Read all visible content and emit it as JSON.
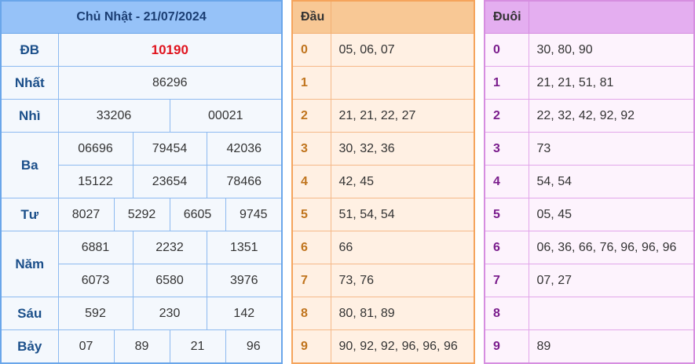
{
  "header": {
    "title": "Chủ Nhật - 21/07/2024"
  },
  "prizes": {
    "db": {
      "label": "ĐB",
      "values": [
        "10190"
      ]
    },
    "nhat": {
      "label": "Nhất",
      "values": [
        "86296"
      ]
    },
    "nhi": {
      "label": "Nhì",
      "values": [
        "33206",
        "00021"
      ]
    },
    "ba": {
      "label": "Ba",
      "values": [
        "06696",
        "79454",
        "42036",
        "15122",
        "23654",
        "78466"
      ]
    },
    "tu": {
      "label": "Tư",
      "values": [
        "8027",
        "5292",
        "6605",
        "9745"
      ]
    },
    "nam": {
      "label": "Năm",
      "values": [
        "6881",
        "2232",
        "1351",
        "6073",
        "6580",
        "3976"
      ]
    },
    "sau": {
      "label": "Sáu",
      "values": [
        "592",
        "230",
        "142"
      ]
    },
    "bay": {
      "label": "Bảy",
      "values": [
        "07",
        "89",
        "21",
        "96"
      ]
    }
  },
  "dau": {
    "title": "Đầu",
    "rows": [
      {
        "digit": "0",
        "values": "05, 06, 07"
      },
      {
        "digit": "1",
        "values": ""
      },
      {
        "digit": "2",
        "values": "21, 21, 22, 27"
      },
      {
        "digit": "3",
        "values": "30, 32, 36"
      },
      {
        "digit": "4",
        "values": "42, 45"
      },
      {
        "digit": "5",
        "values": "51, 54, 54"
      },
      {
        "digit": "6",
        "values": "66"
      },
      {
        "digit": "7",
        "values": "73, 76"
      },
      {
        "digit": "8",
        "values": "80, 81, 89"
      },
      {
        "digit": "9",
        "values": "90, 92, 92, 96, 96, 96"
      }
    ]
  },
  "duoi": {
    "title": "Đuôi",
    "rows": [
      {
        "digit": "0",
        "values": "30, 80, 90"
      },
      {
        "digit": "1",
        "values": "21, 21, 51, 81"
      },
      {
        "digit": "2",
        "values": "22, 32, 42, 92, 92"
      },
      {
        "digit": "3",
        "values": "73"
      },
      {
        "digit": "4",
        "values": "54, 54"
      },
      {
        "digit": "5",
        "values": "05, 45"
      },
      {
        "digit": "6",
        "values": "06, 36, 66, 76, 96, 96, 96"
      },
      {
        "digit": "7",
        "values": "07, 27"
      },
      {
        "digit": "8",
        "values": ""
      },
      {
        "digit": "9",
        "values": "89"
      }
    ]
  }
}
